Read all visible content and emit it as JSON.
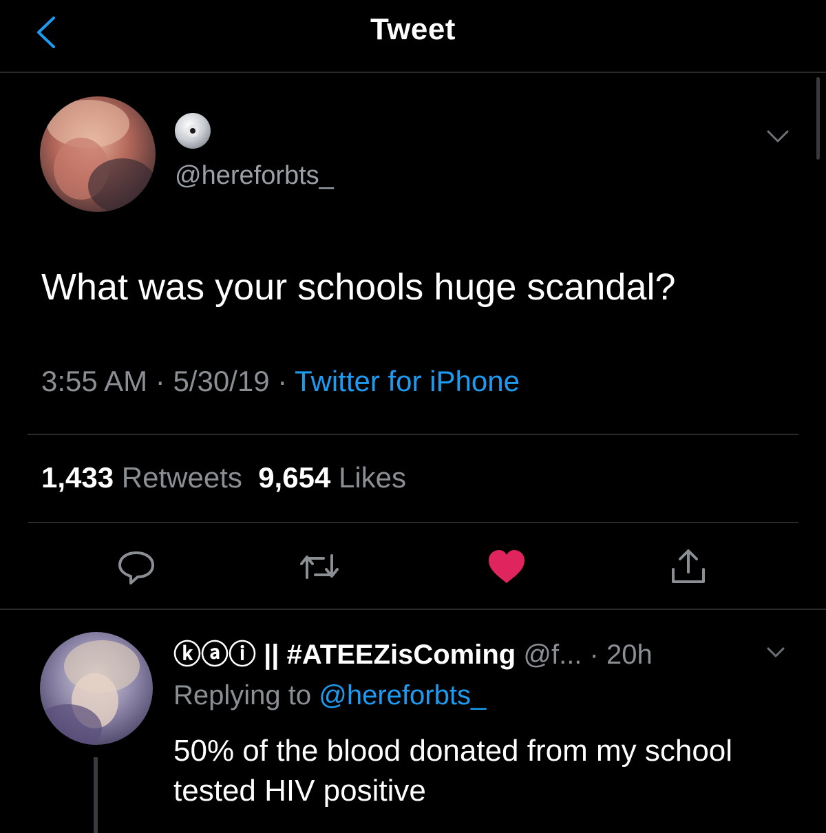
{
  "header": {
    "title": "Tweet"
  },
  "tweet": {
    "handle": "@hereforbts_",
    "text": "What was your schools huge scandal?",
    "time": "3:55 AM",
    "date": "5/30/19",
    "source": "Twitter for iPhone",
    "retweets_count": "1,433",
    "retweets_label": "Retweets",
    "likes_count": "9,654",
    "likes_label": "Likes",
    "liked": true,
    "like_color": "#e0245e",
    "link_color": "#1d9bf0"
  },
  "actions": [
    "reply-icon",
    "retweet-icon",
    "like-icon",
    "share-icon"
  ],
  "reply": {
    "display_name": "ⓚⓐⓘ || #ATEEZisComing",
    "handle": "@f...",
    "time": "· 20h",
    "replying_prefix": "Replying to",
    "replying_handle": "@hereforbts_",
    "text": "50% of the blood donated from my school tested HIV positive"
  }
}
